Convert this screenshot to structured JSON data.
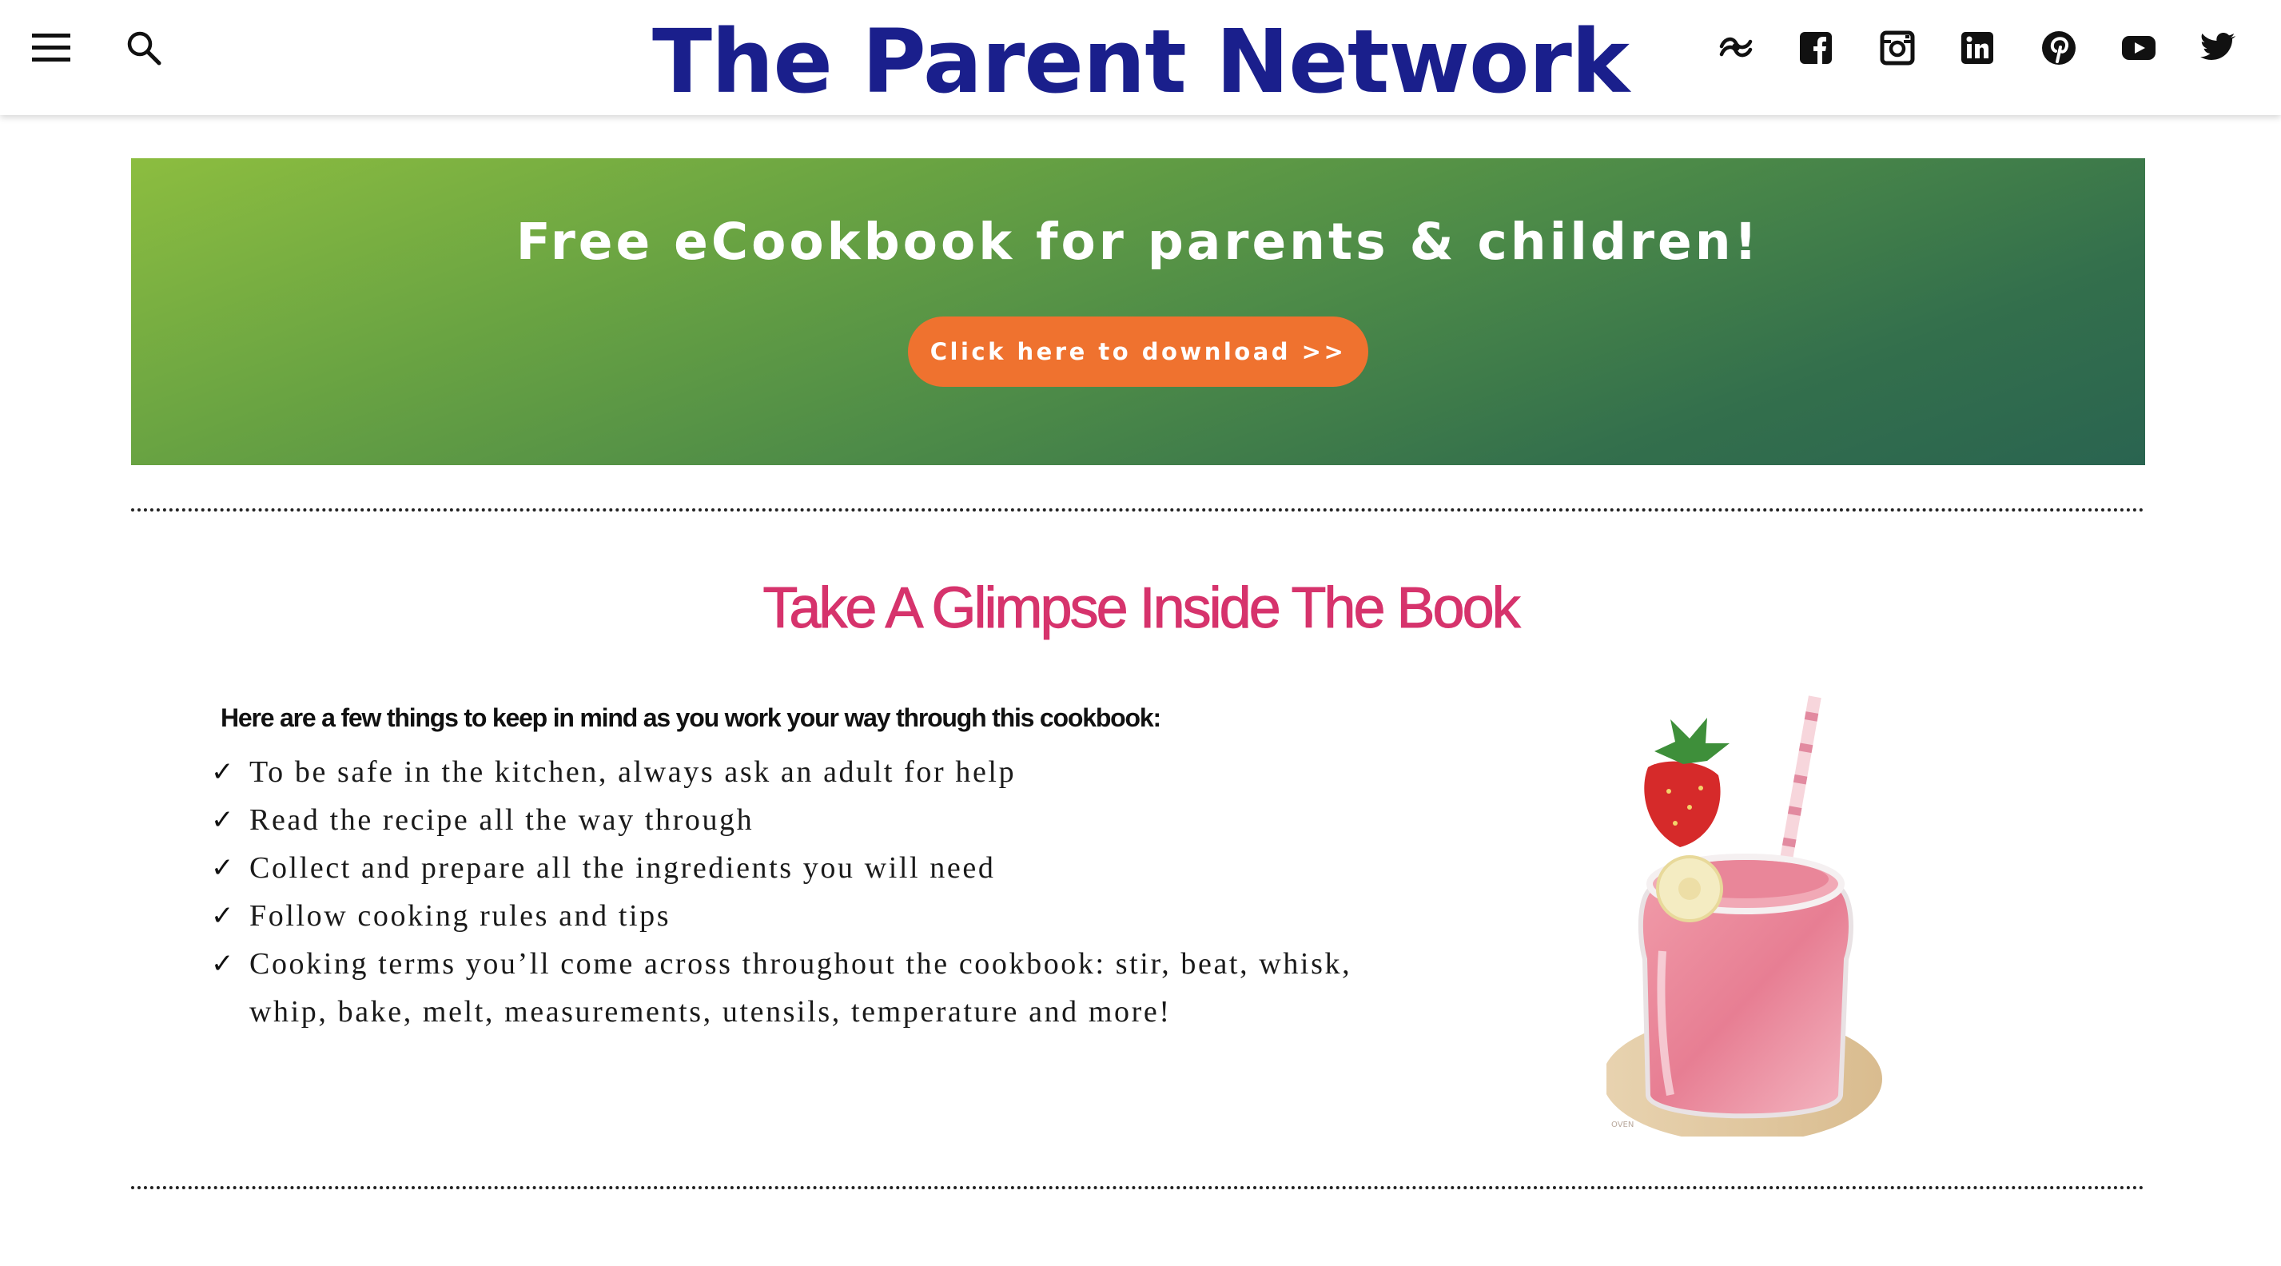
{
  "header": {
    "site_title": "The Parent Network",
    "menu_icon": "hamburger-menu-icon",
    "search_icon": "search-icon",
    "social_icons": [
      "custom-logo-icon",
      "facebook-icon",
      "instagram-icon",
      "linkedin-icon",
      "pinterest-icon",
      "youtube-icon",
      "twitter-icon"
    ]
  },
  "banner": {
    "title": "Free eCookbook for parents & children!",
    "button_label": "Click here to download >>",
    "colors": {
      "gradient_start": "#8cbd40",
      "gradient_end": "#2a6450",
      "button": "#ef722f"
    }
  },
  "section": {
    "title": "Take A Glimpse Inside The Book",
    "title_color": "#d6336c",
    "intro": "Here are a few things to keep in mind as you work your way through this cookbook:",
    "check_glyph": "✓",
    "tips": [
      "To be safe in the kitchen, always ask an adult for help",
      "Read the recipe all the way through",
      "Collect and prepare all the ingredients you will need",
      "Follow cooking rules and tips",
      "Cooking terms you’ll come across throughout the cookbook: stir, beat, whisk, whip, bake, melt, measurements, utensils, temperature and more!"
    ]
  },
  "colors": {
    "title_blue": "#1a1f8c"
  }
}
